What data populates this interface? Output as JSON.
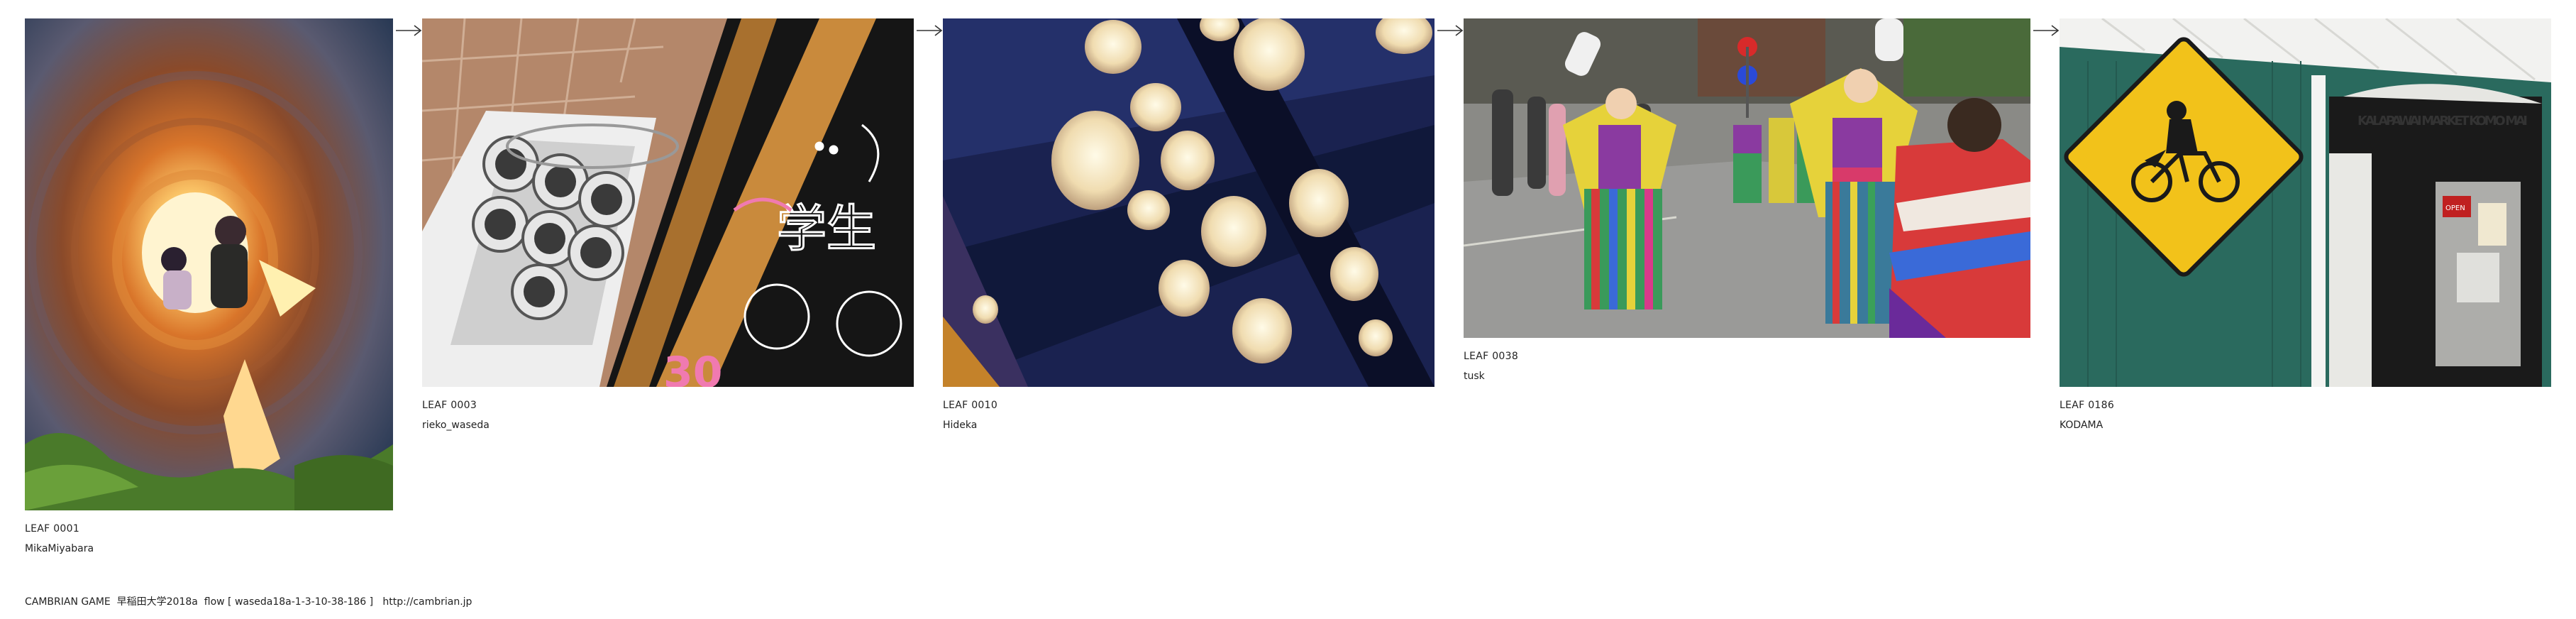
{
  "leaves": [
    {
      "id": "LEAF 0001",
      "author": "MikaMiyabara",
      "image": "tunnel-children-photo"
    },
    {
      "id": "LEAF 0003",
      "author": "rieko_waseda",
      "image": "tin-cans-chalkboard-photo"
    },
    {
      "id": "LEAF 0010",
      "author": "Hideka",
      "image": "paper-lanterns-ceiling-photo"
    },
    {
      "id": "LEAF 0038",
      "author": "tusk",
      "image": "street-dance-festival-photo"
    },
    {
      "id": "LEAF 0186",
      "author": "KODAMA",
      "image": "bicycle-sign-market-photo"
    }
  ],
  "footer": {
    "text": "CAMBRIAN GAME  早稲田大学2018a  flow [ waseda18a-1-3-10-38-186 ]   http://cambrian.jp"
  },
  "photo_text": {
    "chalk_kanji": "学生",
    "chalk_number": "30",
    "market_sign": "KALAPAWAI MARKET KOMO MAI",
    "open_sign": "OPEN"
  }
}
